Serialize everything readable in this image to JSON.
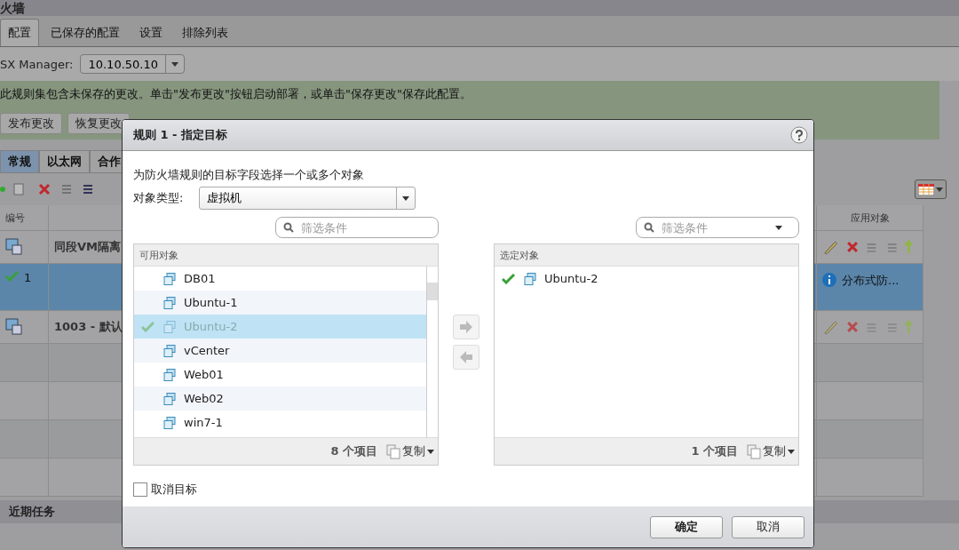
{
  "page": {
    "title": "火墙",
    "tabs": [
      {
        "label": "配置",
        "selected": true
      },
      {
        "label": "已保存的配置",
        "selected": false
      },
      {
        "label": "设置",
        "selected": false
      },
      {
        "label": "排除列表",
        "selected": false
      }
    ],
    "manager_label": "SX Manager:",
    "manager_value": "10.10.50.10",
    "notice": "此规则集包含未保存的更改。单击\"发布更改\"按钮启动部署，或单击\"保存更改\"保存此配置。",
    "actions": [
      "发布更改",
      "恢复更改"
    ],
    "subtabs": [
      {
        "label": "常规",
        "selected": true
      },
      {
        "label": "以太网",
        "selected": false
      },
      {
        "label": "合作",
        "selected": false
      }
    ],
    "table": {
      "columns": [
        "编号",
        "应用对象"
      ],
      "rows": [
        {
          "kind": "section",
          "name": "同段VM隔离",
          "selected": false
        },
        {
          "kind": "rule",
          "number": "1",
          "applied_to": "分布式防...",
          "selected": true
        },
        {
          "kind": "section",
          "name": "1003 - 默认",
          "selected": false
        }
      ]
    },
    "recent_tasks": "近期任务"
  },
  "dialog": {
    "title": "规则 1 - 指定目标",
    "instruction": "为防火墙规则的目标字段选择一个或多个对象",
    "type_label": "对象类型:",
    "type_value": "虚拟机",
    "available": {
      "placeholder": "筛选条件",
      "header": "可用对象",
      "items": [
        {
          "name": "DB01",
          "selected": false,
          "added": false
        },
        {
          "name": "Ubuntu-1",
          "selected": false,
          "added": false
        },
        {
          "name": "Ubuntu-2",
          "selected": true,
          "added": true
        },
        {
          "name": "vCenter",
          "selected": false,
          "added": false
        },
        {
          "name": "Web01",
          "selected": false,
          "added": false
        },
        {
          "name": "Web02",
          "selected": false,
          "added": false
        },
        {
          "name": "win7-1",
          "selected": false,
          "added": false
        }
      ],
      "count": "8 个项目",
      "copy": "复制"
    },
    "chosen": {
      "placeholder": "筛选条件",
      "header": "选定对象",
      "items": [
        {
          "name": "Ubuntu-2",
          "selected": false,
          "added": true
        }
      ],
      "count": "1 个项目",
      "copy": "复制"
    },
    "checkbox": {
      "label": "取消目标",
      "checked": false
    },
    "buttons": [
      "确定",
      "取消"
    ]
  }
}
